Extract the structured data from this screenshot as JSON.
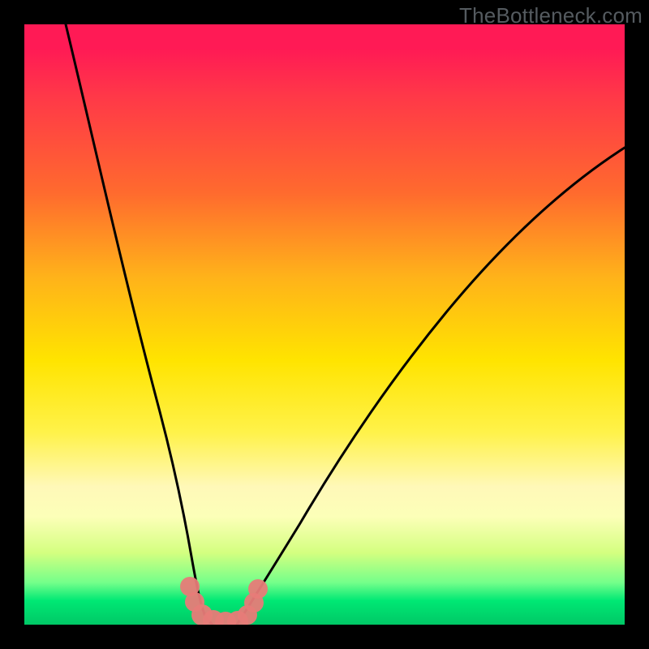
{
  "watermark": "TheBottleneck.com",
  "chart_data": {
    "type": "line",
    "title": "",
    "xlabel": "",
    "ylabel": "",
    "xlim": [
      0,
      100
    ],
    "ylim": [
      0,
      100
    ],
    "series": [
      {
        "name": "curve-left",
        "x": [
          7,
          10,
          13,
          16,
          19,
          22,
          24,
          26,
          27,
          28,
          28.5,
          29,
          30,
          31
        ],
        "y": [
          100,
          84,
          68,
          54,
          41,
          31,
          22,
          15,
          10,
          6,
          4,
          2.5,
          1,
          0
        ]
      },
      {
        "name": "curve-right",
        "x": [
          35,
          37,
          40,
          44,
          49,
          55,
          62,
          70,
          79,
          89,
          100
        ],
        "y": [
          0,
          2,
          6,
          13,
          22,
          33,
          45,
          56,
          66,
          74,
          80
        ]
      },
      {
        "name": "bottom-marker",
        "x": [
          27.5,
          29,
          30,
          31.5,
          33,
          34.5,
          35.5,
          36.5,
          37.5
        ],
        "y": [
          6,
          2,
          0.5,
          0,
          0,
          0.3,
          1,
          3,
          6
        ]
      }
    ],
    "background_gradient": {
      "top": "#ff1a55",
      "mid_upper": "#ffb21a",
      "mid": "#ffe400",
      "lower": "#fcffb8",
      "bottom": "#00c866"
    }
  }
}
